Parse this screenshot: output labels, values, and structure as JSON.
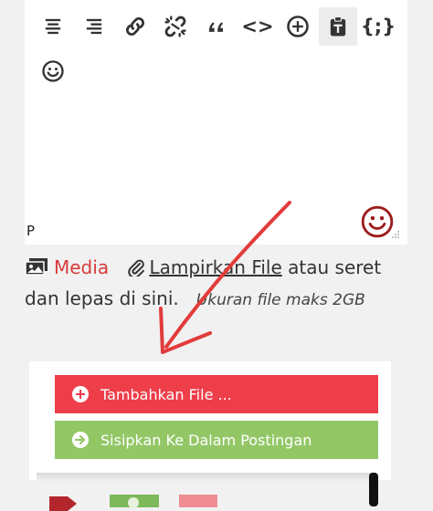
{
  "editor": {
    "paragraph_label": "P",
    "toolbar": {
      "code_label": "<>",
      "shortcode_label": "{;}",
      "items": [
        {
          "icon": "align-center-icon"
        },
        {
          "icon": "align-right-icon"
        },
        {
          "icon": "link-icon"
        },
        {
          "icon": "unlink-icon"
        },
        {
          "icon": "blockquote-icon"
        },
        {
          "icon": "code-icon"
        },
        {
          "icon": "add-circle-icon"
        },
        {
          "icon": "paste-icon"
        },
        {
          "icon": "shortcode-icon"
        },
        {
          "icon": "emoji-icon"
        }
      ]
    }
  },
  "upload": {
    "media_label": "Media",
    "attach_label": "Lampirkan File",
    "rest_text": " atau seret dan lepas di sini.",
    "size_hint": "Ukuran file maks 2GB"
  },
  "actions": {
    "add_file_label": "Tambahkan File ...",
    "insert_label": "Sisipkan Ke Dalam Postingan"
  },
  "colors": {
    "add_button": "#ee3e4a",
    "insert_button": "#93c766",
    "media_link": "#d93a3a",
    "emoji_accent": "#9b1b1b",
    "arrow": "#e23b3b"
  }
}
